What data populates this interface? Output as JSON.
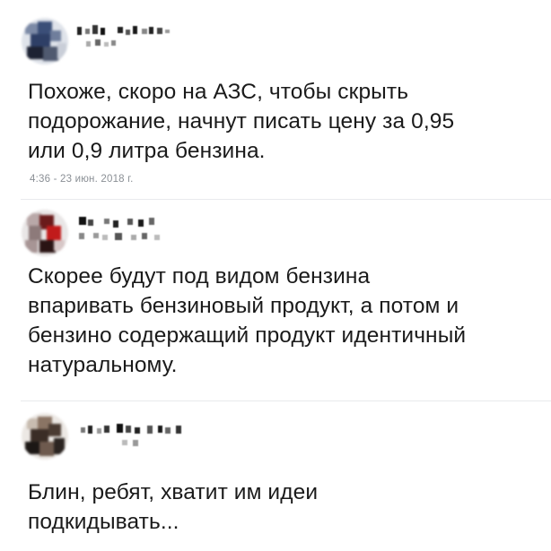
{
  "posts": [
    {
      "text": "Похоже, скоро на АЗС, чтобы скрыть\nподорожание, начнут писать цену за 0,95\nили 0,9 литра бензина.",
      "timestamp": "4:36 - 23 июн. 2018 г."
    },
    {
      "text": "Скорее будут под видом бензина\nвпаривать бензиновый продукт, а потом и\nбензино содержащий продукт идентичный\nнатуральному."
    },
    {
      "text": "Блин, ребят, хватит им идеи\nподкидывать..."
    }
  ],
  "colors": {
    "text": "#1a1a1a",
    "timestamp": "#8a8f95",
    "divider": "#e8eaed"
  }
}
